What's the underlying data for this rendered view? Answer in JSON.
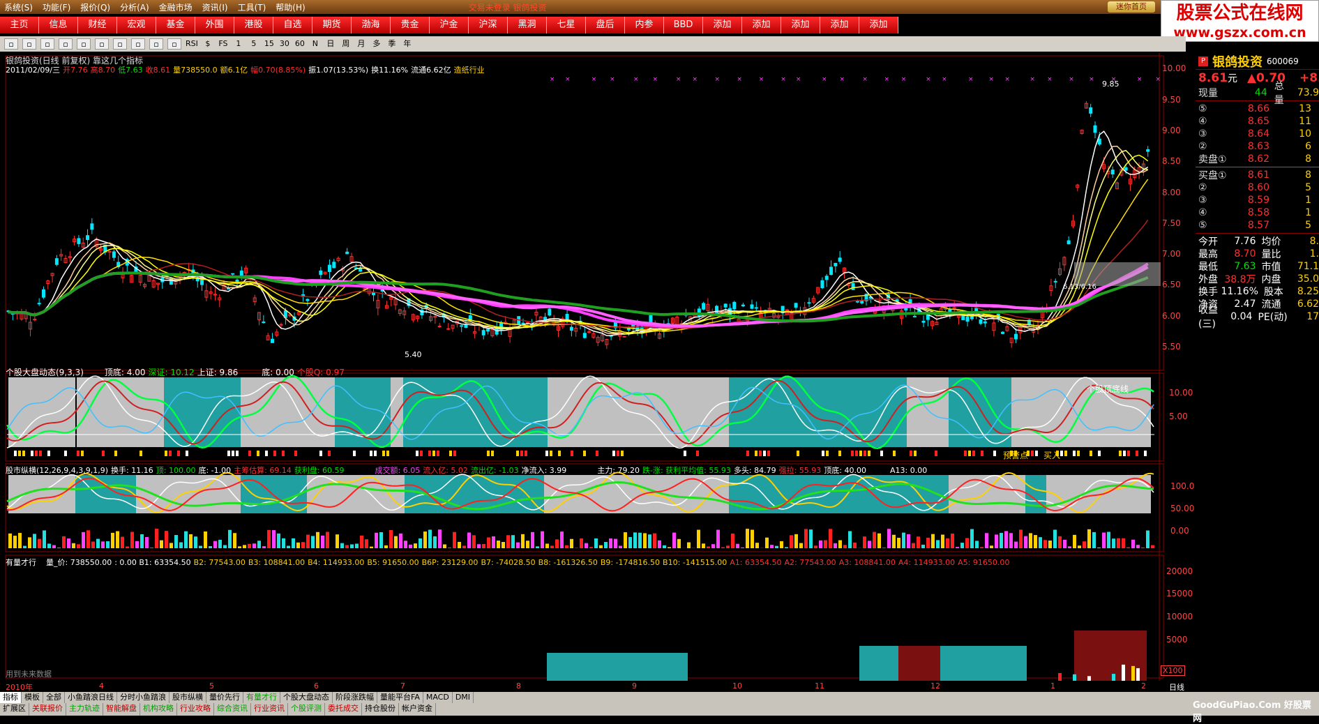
{
  "menu": {
    "items": [
      "系统(S)",
      "功能(F)",
      "报价(Q)",
      "分析(A)",
      "金融市场",
      "资讯(I)",
      "工具(T)",
      "帮助(H)"
    ],
    "highlight": "交易未登录  银鸽投资",
    "home": "迷你首页"
  },
  "ad": {
    "line1": "股票公式在线网",
    "line2": "www.gszx.com.cn"
  },
  "nav": [
    "主页",
    "信息",
    "财经",
    "宏观",
    "基金",
    "外围",
    "港股",
    "自选",
    "期货",
    "渤海",
    "贵金",
    "沪金",
    "沪深",
    "黑洞",
    "七星",
    "盘后",
    "内参",
    "BBD",
    "添加",
    "添加",
    "添加",
    "添加",
    "添加"
  ],
  "toolbar": [
    "RSI",
    "$",
    "FS",
    "1",
    "5",
    "15",
    "30",
    "60",
    "N",
    "日",
    "周",
    "月",
    "多",
    "季",
    "年"
  ],
  "main_header": {
    "title": "银鸽投资(日线 前复权) 靠这几个指标",
    "date": "2011/02/09/三",
    "open": "开7.76",
    "high": "高8.70",
    "low": "低7.63",
    "close": "收8.61",
    "vol": "量738550.0",
    "amt": "额6.1亿",
    "chg": "幅0.70(8.85%)",
    "amp": "振1.07(13.53%)",
    "turn": "换11.16%",
    "flow": "流通6.62亿",
    "industry": "造纸行业"
  },
  "main_axis": [
    "10.00",
    "9.50",
    "9.00",
    "8.50",
    "8.00",
    "7.50",
    "7.00",
    "6.50",
    "6.00",
    "5.50"
  ],
  "main_labels": {
    "high": "9.85",
    "low": "5.40",
    "mid": "6.13/6.16"
  },
  "p1_header": [
    "个股大盘动态(9,3,3)",
    "顶底: 4.00",
    "深证: 10.12",
    "上证: 9.86",
    "底: 0.00",
    "个股Q: 0.97"
  ],
  "p1_axis": [
    "10.00",
    "5.00"
  ],
  "p1_labels": [
    "个股顶底线",
    "预警点",
    "买入"
  ],
  "p2_header": [
    "股市纵横(12,26,9,4,3,9,1,9)",
    "换手: 11.16",
    "顶: 100.00",
    "底: -1.00",
    "主筹估算: 69.14",
    "获利盘: 60.59",
    "成交额: 6.05",
    "流入亿: 5.02",
    "流出亿: -1.03",
    "净流入: 3.99",
    "主力: 79.20",
    "跌-涨: 获利平均值: 55.93",
    "多头: 84.79",
    "强拉: 55.93",
    "顶底: 40.00",
    "A13: 0.00"
  ],
  "p2_axis": [
    "100.0",
    "50.00",
    "0.00"
  ],
  "p3_header": [
    "有量才行",
    "量_价: 738550.00",
    ": 0.00 B1: 63354.50",
    "B2: 77543.00",
    "B3: 108841.00",
    "B4: 114933.00",
    "B5: 91650.00",
    "B6P: 23129.00",
    "B7: -74028.50",
    "B8: -161326.50",
    "B9: -174816.50",
    "B10: -141515.00",
    "A1: 63354.50",
    "A2: 77543.00",
    "A3: 108841.00",
    "A4: 114933.00",
    "A5: 91650.00"
  ],
  "p3_axis": [
    "20000",
    "15000",
    "10000",
    "5000"
  ],
  "p3_footer": "用到未来数据",
  "p3_x100": "X100",
  "dates": [
    "2010年",
    "4",
    "5",
    "6",
    "7",
    "8",
    "9",
    "10",
    "11",
    "12",
    "1",
    "2",
    "日线"
  ],
  "quote": {
    "name": "银鸽投资",
    "code": "600069",
    "price": "8.61",
    "unit": "元",
    "chg": "▲0.70",
    "chgpct": "+8.",
    "now_label": "现量",
    "now": "44",
    "total_label": "总量",
    "total": "73.9",
    "sell": [
      [
        "⑤",
        "8.66",
        "13"
      ],
      [
        "④",
        "8.65",
        "11"
      ],
      [
        "③",
        "8.64",
        "10"
      ],
      [
        "②",
        "8.63",
        "6"
      ],
      [
        "①",
        "8.62",
        "8"
      ]
    ],
    "sell_label": "卖盘",
    "buy_label": "买盘",
    "buy": [
      [
        "①",
        "8.61",
        "8"
      ],
      [
        "②",
        "8.60",
        "5"
      ],
      [
        "③",
        "8.59",
        "1"
      ],
      [
        "④",
        "8.58",
        "1"
      ],
      [
        "⑤",
        "8.57",
        "5"
      ]
    ],
    "stats": [
      [
        "今开",
        "7.76",
        "均价",
        "8."
      ],
      [
        "最高",
        "8.70",
        "量比",
        "1."
      ],
      [
        "最低",
        "7.63",
        "市值",
        "71.1"
      ],
      [
        "外盘",
        "38.8万",
        "内盘",
        "35.0"
      ],
      [
        "换手",
        "11.16%",
        "股本",
        "8.25"
      ],
      [
        "净资",
        "2.47",
        "流通",
        "6.62"
      ],
      [
        "收益(三)",
        "0.04",
        "PE(动)",
        "17"
      ]
    ]
  },
  "tabs1": [
    "指标",
    "模板",
    "全部",
    "小鱼踏浪日线",
    "分时小鱼踏浪",
    "股市纵横",
    "量价先行",
    "有量才行",
    "个股大盘动态",
    "阶段涨跌幅",
    "量能平台FA",
    "MACD",
    "DMI"
  ],
  "tabs2": [
    "扩展区",
    "关联报价",
    "主力轨迹",
    "智能解盘",
    "机构攻略",
    "行业攻略",
    "综合资讯",
    "行业资讯",
    "个股评测",
    "委托成交",
    "持仓股份",
    "帐户资金"
  ],
  "watermark": "GoodGuPiao.Com 好股票网"
}
